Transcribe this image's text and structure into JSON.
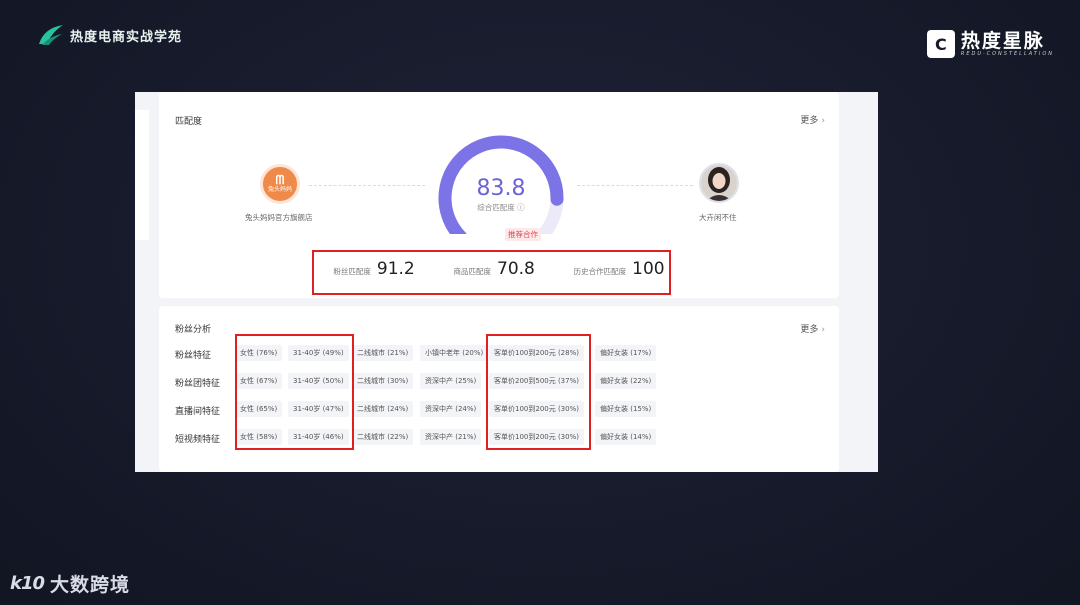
{
  "branding": {
    "top_left": "热度电商实战学苑",
    "top_right_logo_glyph": "C",
    "top_right_title": "热度星脉",
    "top_right_subtitle": "REDU·CONSTELLATION",
    "bottom_left_mark": "k10",
    "bottom_left_text": "大数跨境"
  },
  "match": {
    "title": "匹配度",
    "more": "更多",
    "brand_avatar_text": "兔头妈妈",
    "brand_name": "兔头妈妈官方旗舰店",
    "user_name": "大卉闲不住",
    "score": 83.8,
    "score_fraction": 0.838,
    "score_label": "综合匹配度 ⓘ",
    "recommend_badge": "推荐合作",
    "metrics": [
      {
        "label": "粉丝匹配度",
        "value": "91.2"
      },
      {
        "label": "商品匹配度",
        "value": "70.8"
      },
      {
        "label": "历史合作匹配度",
        "value": "100"
      }
    ],
    "gauge_color": "#7b73e6",
    "gauge_track": "#eceaf9"
  },
  "fans": {
    "title": "粉丝分析",
    "more": "更多",
    "rows": [
      {
        "label": "粉丝特征",
        "tags": [
          "女性 (76%)",
          "31-40岁 (49%)",
          "二线城市 (21%)",
          "小镇中老年 (20%)",
          "客单价100到200元 (28%)",
          "偏好女装 (17%)"
        ]
      },
      {
        "label": "粉丝团特征",
        "tags": [
          "女性 (67%)",
          "31-40岁 (50%)",
          "二线城市 (30%)",
          "资深中产 (25%)",
          "客单价200到500元 (37%)",
          "偏好女装 (22%)"
        ]
      },
      {
        "label": "直播间特征",
        "tags": [
          "女性 (65%)",
          "31-40岁 (47%)",
          "二线城市 (24%)",
          "资深中产 (24%)",
          "客单价100到200元 (30%)",
          "偏好女装 (15%)"
        ]
      },
      {
        "label": "短视频特征",
        "tags": [
          "女性 (58%)",
          "31-40岁 (46%)",
          "二线城市 (22%)",
          "资深中产 (21%)",
          "客单价100到200元 (30%)",
          "偏好女装 (14%)"
        ]
      }
    ]
  },
  "colors": {
    "highlight": "#e02020",
    "score": "#6b63d8"
  }
}
